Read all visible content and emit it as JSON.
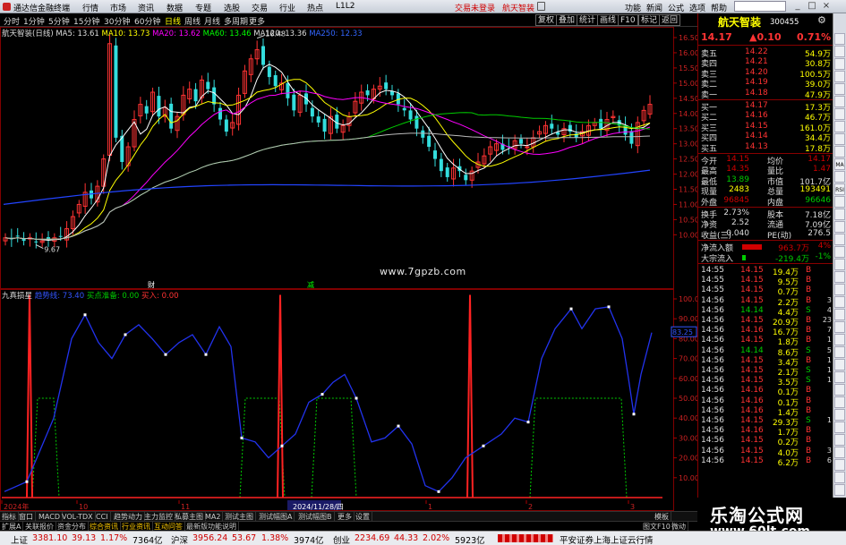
{
  "titlebar": {
    "app_title": "通达信金融终端",
    "menu": [
      "行情",
      "市场",
      "资讯",
      "数据",
      "专题",
      "选股",
      "交易",
      "行业",
      "热点",
      "L1L2"
    ],
    "notice_login": "交易未登录",
    "notice_stock": "航天智装",
    "menu_right": [
      "功能",
      "新闻",
      "公式",
      "选项",
      "帮助"
    ]
  },
  "toolbar": {
    "periods": [
      "分时",
      "1分钟",
      "5分钟",
      "15分钟",
      "30分钟",
      "60分钟",
      "日线",
      "周线",
      "月线",
      "多周期",
      "更多"
    ],
    "active_period": "日线",
    "right_buttons": [
      "复权",
      "叠加",
      "统计",
      "画线",
      "F10",
      "标记",
      "返回"
    ]
  },
  "main_chart": {
    "stock_label": "航天智装(日线)",
    "ma_labels": [
      {
        "text": "MA5: 13.61",
        "color": "#ffffff"
      },
      {
        "text": "MA10: 13.73",
        "color": "#ffff00"
      },
      {
        "text": "MA20: 13.62",
        "color": "#ff00ff"
      },
      {
        "text": "MA60: 13.46",
        "color": "#00ff00"
      },
      {
        "text": "MA120: 13.36",
        "color": "#dddddd"
      },
      {
        "text": "MA250: 12.33",
        "color": "#3366ff"
      }
    ],
    "y_ticks": [
      "16.50",
      "16.00",
      "15.50",
      "15.00",
      "14.50",
      "14.00",
      "13.50",
      "13.00",
      "12.50",
      "12.00",
      "11.50",
      "11.00",
      "10.50",
      "10.00"
    ],
    "high_label": "16.48",
    "low_label": "9.67",
    "marker_cai": "财",
    "marker_jian": "减",
    "watermark": "www.7gpzb.com"
  },
  "sub_chart": {
    "title": "九真损星",
    "line_label": "趋势线: 73.40",
    "buy_ready": "买点准备: 0.00",
    "buy": "买入: 0.00",
    "y_ticks": [
      "100.00",
      "90.00",
      "80.00",
      "70.00",
      "60.00",
      "50.00",
      "40.00",
      "30.00",
      "20.00",
      "10.00"
    ],
    "current_value": "83.25",
    "x_labels": [
      "2024年",
      "10",
      "11",
      "2024/11/28/四",
      "1",
      "2",
      "3"
    ]
  },
  "quote": {
    "name": "航天智装",
    "code": "300455",
    "price": "14.17",
    "change": "▲0.10",
    "pct": "0.71%",
    "asks": [
      {
        "label": "卖五",
        "price": "14.22",
        "vol": "54.9万"
      },
      {
        "label": "卖四",
        "price": "14.21",
        "vol": "30.8万"
      },
      {
        "label": "卖三",
        "price": "14.20",
        "vol": "100.5万"
      },
      {
        "label": "卖二",
        "price": "14.19",
        "vol": "39.0万"
      },
      {
        "label": "卖一",
        "price": "14.18",
        "vol": "47.9万"
      }
    ],
    "bids": [
      {
        "label": "买一",
        "price": "14.17",
        "vol": "17.3万"
      },
      {
        "label": "买二",
        "price": "14.16",
        "vol": "46.7万"
      },
      {
        "label": "买三",
        "price": "14.15",
        "vol": "161.0万"
      },
      {
        "label": "买四",
        "price": "14.14",
        "vol": "34.4万"
      },
      {
        "label": "买五",
        "price": "14.13",
        "vol": "17.8万"
      }
    ],
    "stats": [
      {
        "l1": "今开",
        "v1": "14.15",
        "c1": "#d00000",
        "l2": "均价",
        "v2": "14.17",
        "c2": "#d00000"
      },
      {
        "l1": "最高",
        "v1": "14.35",
        "c1": "#d00000",
        "l2": "量比",
        "v2": "1.47",
        "c2": "#d00000"
      },
      {
        "l1": "最低",
        "v1": "13.89",
        "c1": "#00cc00",
        "l2": "市值",
        "v2": "101.7亿",
        "c2": "#dddddd"
      },
      {
        "l1": "现量",
        "v1": "2483",
        "c1": "#ffff00",
        "l2": "总量",
        "v2": "193491",
        "c2": "#ffff00"
      },
      {
        "l1": "外盘",
        "v1": "96845",
        "c1": "#d00000",
        "l2": "内盘",
        "v2": "96646",
        "c2": "#00cc00"
      },
      {
        "l1": "换手",
        "v1": "2.73%",
        "c1": "#dddddd",
        "l2": "股本",
        "v2": "7.18亿",
        "c2": "#dddddd"
      },
      {
        "l1": "净资",
        "v1": "2.52",
        "c1": "#dddddd",
        "l2": "流通",
        "v2": "7.09亿",
        "c2": "#dddddd"
      },
      {
        "l1": "收益(三)",
        "v1": "0.040",
        "c1": "#dddddd",
        "l2": "PE(动)",
        "v2": "276.5",
        "c2": "#dddddd"
      }
    ],
    "flow": [
      {
        "label": "净流入额",
        "value": "963.7万",
        "pct": "4%",
        "color": "#d00000",
        "bar": 0.55
      },
      {
        "label": "大宗流入",
        "value": "-219.4万",
        "pct": "-1%",
        "color": "#00cc00",
        "bar": 0.1
      }
    ],
    "ticks": [
      {
        "t": "14:55",
        "p": "14.15",
        "v": "19.4万",
        "s": "B"
      },
      {
        "t": "14:55",
        "p": "14.15",
        "v": "9.5万",
        "s": "B"
      },
      {
        "t": "14:55",
        "p": "14.15",
        "v": "0.7万",
        "s": "B"
      },
      {
        "t": "14:56",
        "p": "14.15",
        "v": "2.2万",
        "s": "B"
      },
      {
        "t": "14:56",
        "p": "14.14",
        "v": "4.4万",
        "s": "S"
      },
      {
        "t": "14:56",
        "p": "14.15",
        "v": "20.9万",
        "s": "B"
      },
      {
        "t": "14:56",
        "p": "14.16",
        "v": "16.7万",
        "s": "B"
      },
      {
        "t": "14:56",
        "p": "14.15",
        "v": "1.8万",
        "s": "B"
      },
      {
        "t": "14:56",
        "p": "14.14",
        "v": "8.6万",
        "s": "S"
      },
      {
        "t": "14:56",
        "p": "14.15",
        "v": "3.4万",
        "s": "B"
      },
      {
        "t": "14:56",
        "p": "14.15",
        "v": "2.1万",
        "s": "S"
      },
      {
        "t": "14:56",
        "p": "14.15",
        "v": "3.5万",
        "s": "S"
      },
      {
        "t": "14:56",
        "p": "14.16",
        "v": "0.1万",
        "s": "B"
      },
      {
        "t": "14:56",
        "p": "14.16",
        "v": "0.1万",
        "s": "B"
      },
      {
        "t": "14:56",
        "p": "14.16",
        "v": "1.4万",
        "s": "B"
      },
      {
        "t": "14:56",
        "p": "14.15",
        "v": "29.3万",
        "s": "S"
      },
      {
        "t": "14:56",
        "p": "14.16",
        "v": "1.7万",
        "s": "B"
      },
      {
        "t": "14:56",
        "p": "14.15",
        "v": "0.2万",
        "s": "B"
      },
      {
        "t": "14:56",
        "p": "14.15",
        "v": "4.0万",
        "s": "B"
      },
      {
        "t": "14:56",
        "p": "14.15",
        "v": "6.2万",
        "s": "B"
      }
    ],
    "tick_counts": [
      "",
      "",
      "",
      "3",
      "4",
      "23",
      "7",
      "1",
      "5",
      "1",
      "1",
      "1",
      "",
      "",
      "",
      "1",
      "",
      "",
      "3",
      "6"
    ],
    "side_tools": [
      "MA",
      "RSI"
    ]
  },
  "bottom_tabs": [
    "指标",
    "窗口",
    "MACD",
    "VOL-TDX",
    "CCI",
    "趋势动力",
    "主力监控",
    "私募主图",
    "MA2",
    "测试主图",
    "测试幅图A",
    "测试幅图B",
    "更多",
    "设置"
  ],
  "bottom_tabs_right": "模板",
  "bottom_tabs2": [
    "扩展A",
    "关联报价",
    "资金分布",
    "综合资讯",
    "行业资讯",
    "互动问答",
    "最新版功能说明"
  ],
  "status": {
    "sh_label": "上证",
    "sh_val": "3381.10",
    "sh_chg": "39.13",
    "sh_pct": "1.17%",
    "sh_amt": "7364亿",
    "sz_label": "沪深",
    "sz_val": "3956.24",
    "sz_chg": "53.67",
    "sz_pct": "1.38%",
    "sz_amt": "3974亿",
    "cy_label": "创业",
    "cy_val": "2234.69",
    "cy_chg": "44.33",
    "cy_pct": "2.02%",
    "cy_amt": "5923亿",
    "broker": "平安证券上海上证云行情"
  },
  "watermark2": {
    "a": "乐淘公式网",
    "b": "www.60lt.com"
  },
  "side_right_tabs": [
    "图文F10",
    "微动"
  ]
}
